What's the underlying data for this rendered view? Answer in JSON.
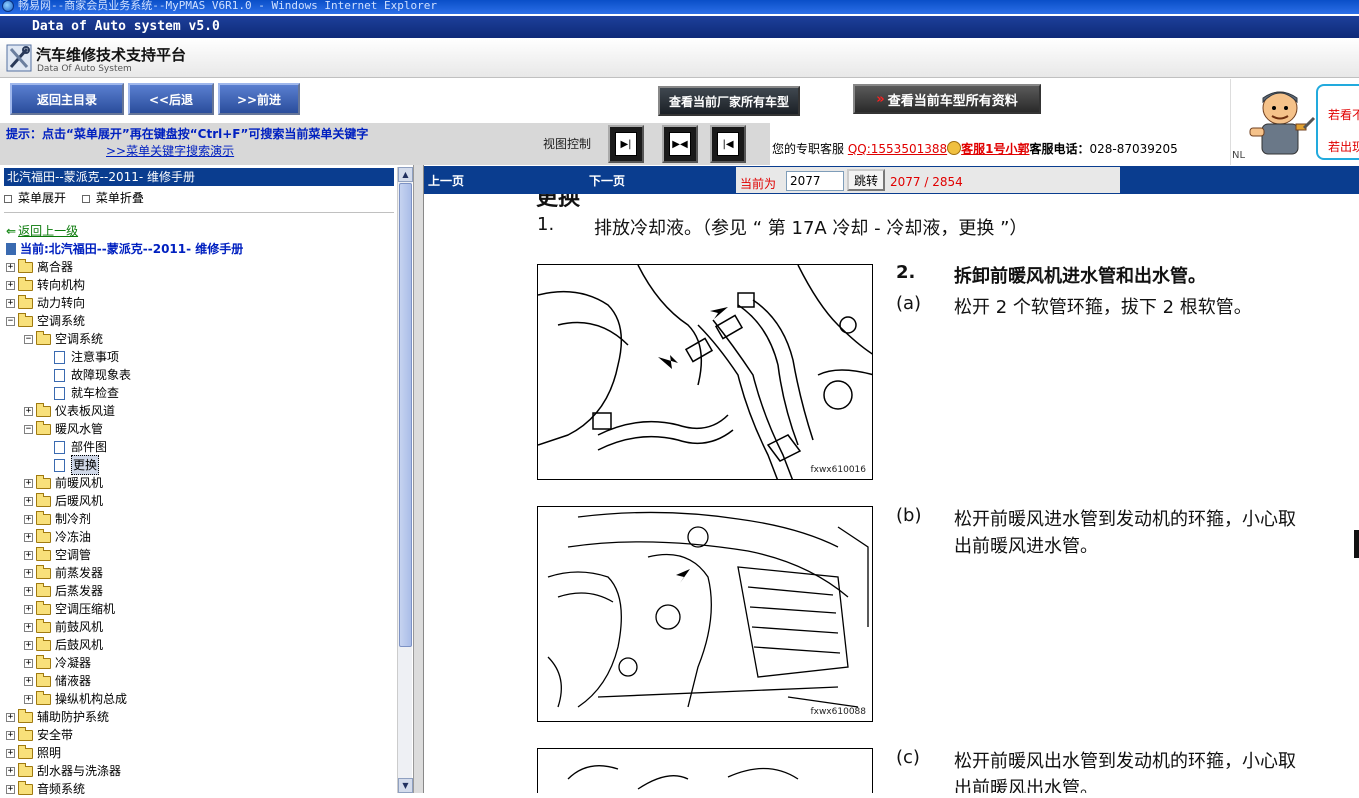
{
  "window": {
    "ie_title": "畅易网--商家会员业务系统--MyPMAS V6R1.0 - Windows Internet Explorer",
    "app_title": "Data of Auto system v5.0"
  },
  "header": {
    "brand_title": "汽车维修技术支持平台",
    "brand_subtitle": "Data Of Auto System"
  },
  "toolbar": {
    "home": "返回主目录",
    "back": "<<后退",
    "forward": ">>前进",
    "all_models": "查看当前厂家所有车型",
    "all_docs": "查看当前车型所有资料"
  },
  "mascot": {
    "link1": "若看不",
    "link2": "若出现"
  },
  "hint": {
    "text": "提示：点击“菜单展开”再在键盘按“Ctrl+F”可搜索当前菜单关键字",
    "link": ">>菜单关键字搜索演示",
    "view_label": "视图控制"
  },
  "support": {
    "prefix": "您的专职客服",
    "qq": "QQ:1553501388",
    "agent": "客服1号小郭",
    "tel_label": "客服电话：",
    "tel": "028-87039205",
    "nl": "NL"
  },
  "tree": {
    "header": "北汽福田--蒙派克--2011- 维修手册",
    "expand": "菜单展开",
    "collapse": "菜单折叠",
    "back_up": "返回上一级",
    "current": "当前:北汽福田--蒙派克--2011- 维修手册",
    "items": [
      {
        "label": "离合器",
        "level": 0,
        "type": "folder",
        "pm": "+"
      },
      {
        "label": "转向机构",
        "level": 0,
        "type": "folder",
        "pm": "+"
      },
      {
        "label": "动力转向",
        "level": 0,
        "type": "folder",
        "pm": "+"
      },
      {
        "label": "空调系统",
        "level": 0,
        "type": "folder",
        "pm": "-"
      },
      {
        "label": "空调系统",
        "level": 1,
        "type": "folder",
        "pm": "-"
      },
      {
        "label": "注意事项",
        "level": 2,
        "type": "doc"
      },
      {
        "label": "故障现象表",
        "level": 2,
        "type": "doc"
      },
      {
        "label": "就车检查",
        "level": 2,
        "type": "doc"
      },
      {
        "label": "仪表板风道",
        "level": 1,
        "type": "folder",
        "pm": "+"
      },
      {
        "label": "暖风水管",
        "level": 1,
        "type": "folder",
        "pm": "-"
      },
      {
        "label": "部件图",
        "level": 2,
        "type": "doc"
      },
      {
        "label": "更换",
        "level": 2,
        "type": "doc",
        "selected": true
      },
      {
        "label": "前暖风机",
        "level": 1,
        "type": "folder",
        "pm": "+"
      },
      {
        "label": "后暖风机",
        "level": 1,
        "type": "folder",
        "pm": "+"
      },
      {
        "label": "制冷剂",
        "level": 1,
        "type": "folder",
        "pm": "+"
      },
      {
        "label": "冷冻油",
        "level": 1,
        "type": "folder",
        "pm": "+"
      },
      {
        "label": "空调管",
        "level": 1,
        "type": "folder",
        "pm": "+"
      },
      {
        "label": "前蒸发器",
        "level": 1,
        "type": "folder",
        "pm": "+"
      },
      {
        "label": "后蒸发器",
        "level": 1,
        "type": "folder",
        "pm": "+"
      },
      {
        "label": "空调压缩机",
        "level": 1,
        "type": "folder",
        "pm": "+"
      },
      {
        "label": "前鼓风机",
        "level": 1,
        "type": "folder",
        "pm": "+"
      },
      {
        "label": "后鼓风机",
        "level": 1,
        "type": "folder",
        "pm": "+"
      },
      {
        "label": "冷凝器",
        "level": 1,
        "type": "folder",
        "pm": "+"
      },
      {
        "label": "储液器",
        "level": 1,
        "type": "folder",
        "pm": "+"
      },
      {
        "label": "操纵机构总成",
        "level": 1,
        "type": "folder",
        "pm": "+"
      },
      {
        "label": "辅助防护系统",
        "level": 0,
        "type": "folder",
        "pm": "+"
      },
      {
        "label": "安全带",
        "level": 0,
        "type": "folder",
        "pm": "+"
      },
      {
        "label": "照明",
        "level": 0,
        "type": "folder",
        "pm": "+"
      },
      {
        "label": "刮水器与洗涤器",
        "level": 0,
        "type": "folder",
        "pm": "+"
      },
      {
        "label": "音频系统",
        "level": 0,
        "type": "folder",
        "pm": "+"
      }
    ]
  },
  "pager": {
    "prev": "上一页",
    "next": "下一页",
    "current_label": "当前为",
    "current_value": "2077",
    "jump": "跳转",
    "count": "2077 / 2854"
  },
  "document": {
    "heading": "更换",
    "step1_num": "1.",
    "step1": "排放冷却液。（参见 “ 第 17A 冷却 - 冷却液，更换 ”）",
    "step2_num": "2.",
    "step2": "拆卸前暖风机进水管和出水管。",
    "a_tag": "(a)",
    "a_text": "松开 2 个软管环箍，拔下 2 根软管。",
    "b_tag": "(b)",
    "b_text_1": "松开前暖风进水管到发动机的环箍，小心取",
    "b_text_2": "出前暖风进水管。",
    "c_tag": "(c)",
    "c_text_1": "松开前暖风出水管到发动机的环箍，小心取",
    "c_text_2": "出前暖风出水管。",
    "fig1_code": "fxwx610016",
    "fig2_code": "fxwx610088"
  }
}
